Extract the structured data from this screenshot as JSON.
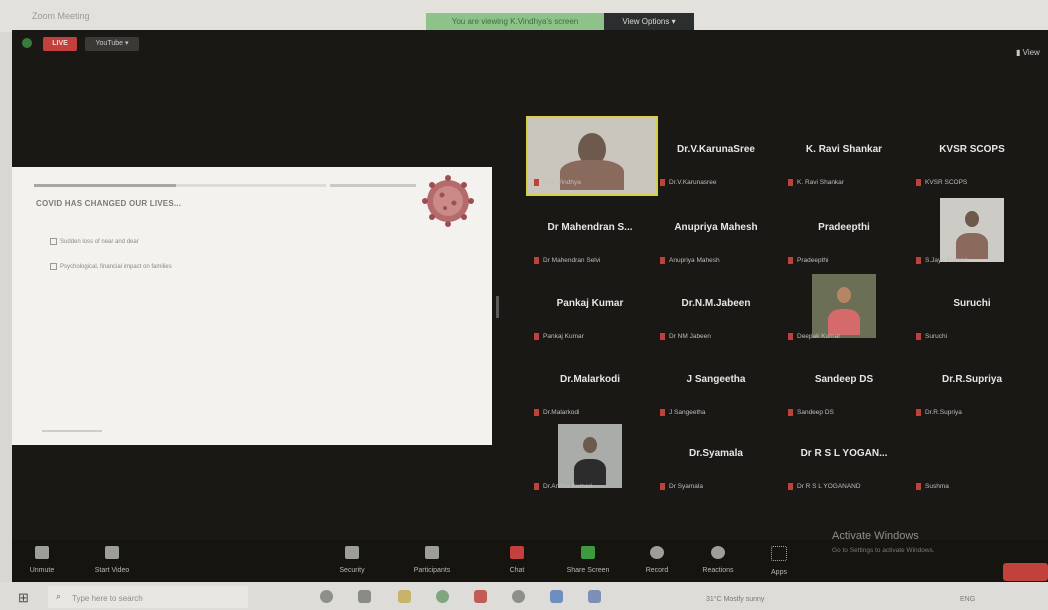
{
  "window": {
    "title": "Zoom Meeting"
  },
  "share_banner": {
    "text": "You are viewing K.Vindhya's screen",
    "view_options_label": "View Options ▾"
  },
  "top_left": {
    "live_label": "LIVE",
    "youtube_label": "YouTube ▾"
  },
  "view_corner": {
    "label": "▮ View"
  },
  "slide": {
    "title": "COVID HAS CHANGED OUR LIVES...",
    "bullets": [
      "Sudden loss of near and dear",
      "Psychological, financial impact on families"
    ]
  },
  "participants": [
    {
      "name": "",
      "label": "Dr.K.Vindhya",
      "video": true
    },
    {
      "name": "Dr.V.KarunaSree",
      "label": "Dr.V.Karunasree",
      "video": false
    },
    {
      "name": "K. Ravi Shankar",
      "label": "K. Ravi Shankar",
      "video": false
    },
    {
      "name": "KVSR SCOPS",
      "label": "KVSR SCOPS",
      "video": false
    },
    {
      "name": "Dr Mahendran S...",
      "label": "Dr Mahendran Selvi",
      "video": false
    },
    {
      "name": "Anupriya Mahesh",
      "label": "Anupriya Mahesh",
      "video": false
    },
    {
      "name": "Pradeepthi",
      "label": "Pradeepthi",
      "video": false
    },
    {
      "name": "",
      "label": "S.Jaya Kumari",
      "video": true
    },
    {
      "name": "Pankaj Kumar",
      "label": "Pankaj Kumar",
      "video": false
    },
    {
      "name": "Dr.N.M.Jabeen",
      "label": "Dr NM Jabeen",
      "video": false
    },
    {
      "name": "",
      "label": "Deepak Kumar",
      "video": true
    },
    {
      "name": "Suruchi",
      "label": "Suruchi",
      "video": false
    },
    {
      "name": "Dr.Malarkodi",
      "label": "Dr.Malarkodi",
      "video": false
    },
    {
      "name": "J Sangeetha",
      "label": "J Sangeetha",
      "video": false
    },
    {
      "name": "Sandeep DS",
      "label": "Sandeep DS",
      "video": false
    },
    {
      "name": "Dr.R.Supriya",
      "label": "Dr.R.Supriya",
      "video": false
    },
    {
      "name": "",
      "label": "Dr.Anitha Kumari",
      "video": true
    },
    {
      "name": "Dr.Syamala",
      "label": "Dr Syamala",
      "video": false
    },
    {
      "name": "Dr R S L YOGAN...",
      "label": "Dr R S L YOGANAND",
      "video": false
    },
    {
      "name": "",
      "label": "Sushma",
      "video": false
    }
  ],
  "toolbar": {
    "items": [
      {
        "label": "Unmute"
      },
      {
        "label": "Start Video"
      },
      {
        "label": "Security"
      },
      {
        "label": "Participants"
      },
      {
        "label": "Chat"
      },
      {
        "label": "Share Screen"
      },
      {
        "label": "Record"
      },
      {
        "label": "Reactions"
      },
      {
        "label": "Apps"
      }
    ]
  },
  "watermark": {
    "line1": "Activate Windows",
    "line2": "Go to Settings to activate Windows."
  },
  "taskbar": {
    "search_placeholder": "Type here to search",
    "weather": "31°C  Mostly sunny",
    "tray": "ENG"
  },
  "colors": {
    "accent_green": "#8fc28a",
    "live_red": "#c2413d",
    "meeting_bg": "#1a1815"
  }
}
